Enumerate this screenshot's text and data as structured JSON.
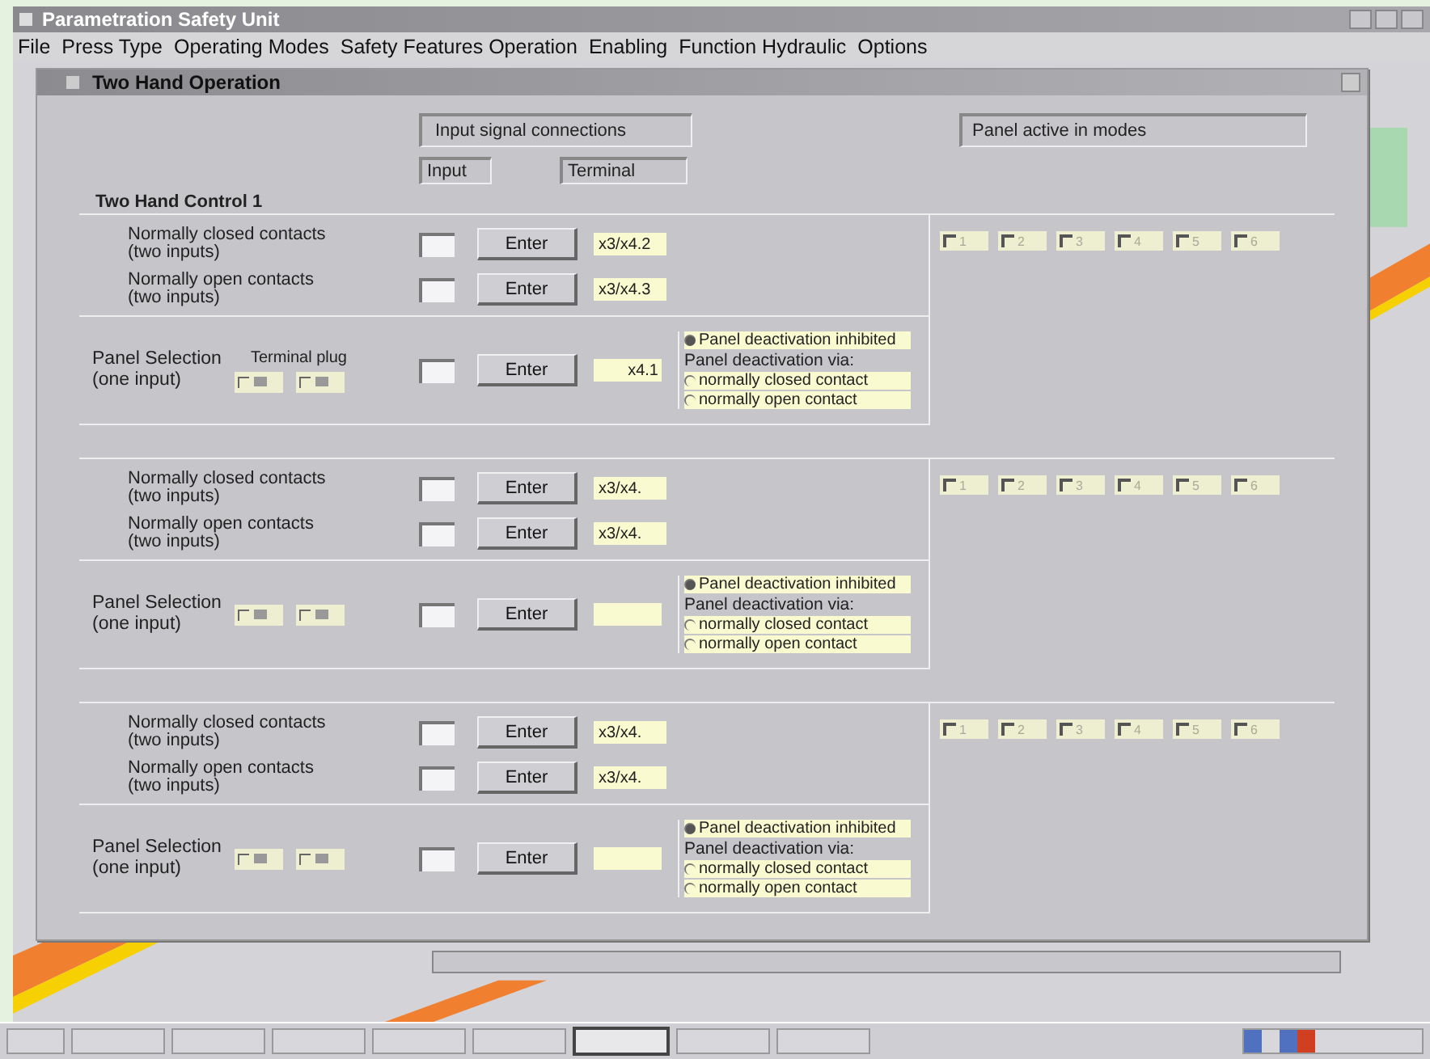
{
  "window": {
    "title": "Parametration Safety Unit"
  },
  "menu": [
    "File",
    "Press Type",
    "Operating Modes",
    "Safety Features Operation",
    "Enabling",
    "Function Hydraulic",
    "Options"
  ],
  "dialog": {
    "title": "Two Hand Operation",
    "headers": {
      "connections": "Input signal connections",
      "input": "Input",
      "terminal": "Terminal",
      "modes": "Panel active in modes"
    },
    "groups": [
      {
        "title": "Two Hand Control 1",
        "contacts": [
          {
            "label": "Normally closed contacts",
            "sub": "(two inputs)",
            "button": "Enter",
            "terminal": "x3/x4.2"
          },
          {
            "label": "Normally open contacts",
            "sub": "(two inputs)",
            "button": "Enter",
            "terminal": "x3/x4.3"
          }
        ],
        "panel": {
          "label": "Panel Selection",
          "sub": "(one input)",
          "plug_label": "Terminal plug",
          "plugs": [
            {
              "selected": false
            },
            {
              "selected": false
            }
          ],
          "button": "Enter",
          "terminal": "x4.1",
          "inhibited": {
            "label": "Panel deactivation inhibited",
            "selected": true
          },
          "via": "Panel deactivation via:",
          "options": [
            {
              "label": "normally closed contact",
              "selected": false
            },
            {
              "label": "normally open contact",
              "selected": false
            }
          ]
        },
        "modes": [
          {
            "label": "1",
            "checked": false
          },
          {
            "label": "2",
            "checked": false
          },
          {
            "label": "3",
            "checked": false
          },
          {
            "label": "4",
            "checked": false
          },
          {
            "label": "5",
            "checked": false
          },
          {
            "label": "6",
            "checked": false
          }
        ]
      },
      {
        "contacts": [
          {
            "label": "Normally closed contacts",
            "sub": "(two inputs)",
            "button": "Enter",
            "terminal": "x3/x4."
          },
          {
            "label": "Normally open contacts",
            "sub": "(two inputs)",
            "button": "Enter",
            "terminal": "x3/x4."
          }
        ],
        "panel": {
          "label": "Panel Selection",
          "sub": "(one input)",
          "plugs": [
            {
              "selected": false
            },
            {
              "selected": false
            }
          ],
          "button": "Enter",
          "inhibited": {
            "label": "Panel deactivation inhibited",
            "selected": true
          },
          "via": "Panel deactivation via:",
          "options": [
            {
              "label": "normally closed contact",
              "selected": false
            },
            {
              "label": "normally open contact",
              "selected": false
            }
          ]
        },
        "modes": [
          {
            "label": "1",
            "checked": false
          },
          {
            "label": "2",
            "checked": false
          },
          {
            "label": "3",
            "checked": false
          },
          {
            "label": "4",
            "checked": false
          },
          {
            "label": "5",
            "checked": false
          },
          {
            "label": "6",
            "checked": false
          }
        ]
      },
      {
        "contacts": [
          {
            "label": "Normally closed contacts",
            "sub": "(two inputs)",
            "button": "Enter",
            "terminal": "x3/x4."
          },
          {
            "label": "Normally open contacts",
            "sub": "(two inputs)",
            "button": "Enter",
            "terminal": "x3/x4."
          }
        ],
        "panel": {
          "label": "Panel Selection",
          "sub": "(one input)",
          "plugs": [
            {
              "selected": false
            },
            {
              "selected": false
            }
          ],
          "button": "Enter",
          "inhibited": {
            "label": "Panel deactivation inhibited",
            "selected": true
          },
          "via": "Panel deactivation via:",
          "options": [
            {
              "label": "normally closed contact",
              "selected": false
            },
            {
              "label": "normally open contact",
              "selected": false
            }
          ]
        },
        "modes": [
          {
            "label": "1",
            "checked": false
          },
          {
            "label": "2",
            "checked": false
          },
          {
            "label": "3",
            "checked": false
          },
          {
            "label": "4",
            "checked": false
          },
          {
            "label": "5",
            "checked": false
          },
          {
            "label": "6",
            "checked": false
          }
        ]
      }
    ]
  }
}
